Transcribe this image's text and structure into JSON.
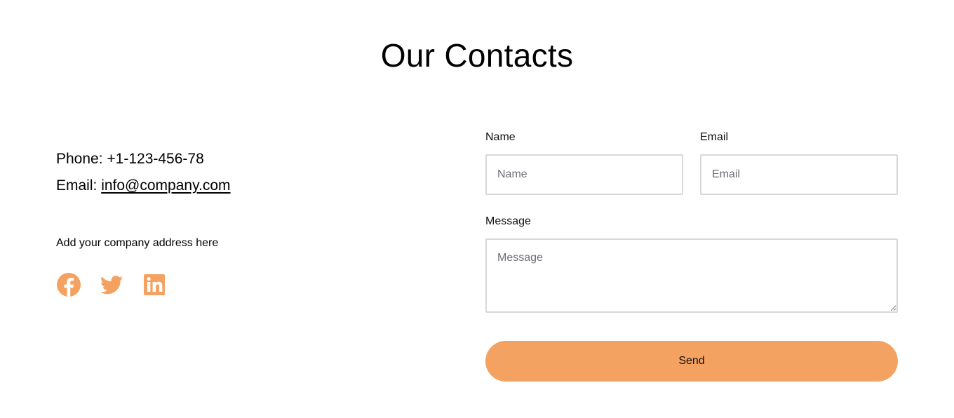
{
  "page": {
    "title": "Our Contacts"
  },
  "contact": {
    "phone_label": "Phone:",
    "phone_value": "+1-123-456-78",
    "email_label": "Email:",
    "email_value": "info@company.com",
    "address": "Add your company address here"
  },
  "socials": [
    {
      "icon": "facebook-icon"
    },
    {
      "icon": "twitter-icon"
    },
    {
      "icon": "linkedin-icon"
    }
  ],
  "form": {
    "name_label": "Name",
    "name_placeholder": "Name",
    "email_label": "Email",
    "email_placeholder": "Email",
    "message_label": "Message",
    "message_placeholder": "Message",
    "send_label": "Send"
  },
  "colors": {
    "accent": "#f4a261",
    "input_border": "#d6d8dc",
    "text": "#000000"
  }
}
